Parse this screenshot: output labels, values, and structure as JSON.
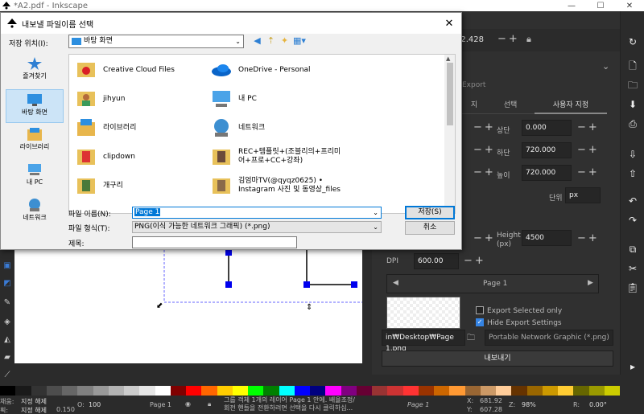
{
  "app": {
    "title": "*A2.pdf - Inkscape",
    "window_controls": [
      "—",
      "☐",
      "✕"
    ]
  },
  "dialog": {
    "title": "내보낼 파일이름 선택",
    "close": "✕",
    "look_in_label": "저장 위치(I):",
    "look_in_value": "바탕 화면",
    "places": [
      {
        "label": "즐겨찾기",
        "icon": "star-icon"
      },
      {
        "label": "바탕 화면",
        "icon": "desktop-icon",
        "selected": true
      },
      {
        "label": "라이브러리",
        "icon": "library-icon"
      },
      {
        "label": "내 PC",
        "icon": "pc-icon"
      },
      {
        "label": "네트워크",
        "icon": "network-icon"
      }
    ],
    "files": [
      {
        "name": "Creative Cloud Files",
        "icon": "cc-folder-icon"
      },
      {
        "name": "OneDrive - Personal",
        "icon": "onedrive-icon"
      },
      {
        "name": "jihyun",
        "icon": "user-folder-icon"
      },
      {
        "name": "내 PC",
        "icon": "pc-icon"
      },
      {
        "name": "라이브러리",
        "icon": "library-folder-icon"
      },
      {
        "name": "네트워크",
        "icon": "network-icon"
      },
      {
        "name": "clipdown",
        "icon": "folder-icon"
      },
      {
        "name": "REC+템플릿+(조블리의+프리미\n어+프로+CC+강좌)",
        "icon": "folder-icon"
      },
      {
        "name": "개구리",
        "icon": "folder-icon"
      },
      {
        "name": "김엄마TV(@qyqz0625) •\nInstagram 사진 및 동영상_files",
        "icon": "folder-icon"
      }
    ],
    "filename_label": "파일 이름(N):",
    "filename_value": "Page 1",
    "filetype_label": "파일 형식(T):",
    "filetype_value": "PNG(이식 가능한 네트워크 그래픽) (*.png)",
    "title_label": "제목:",
    "save_button": "저장(S)",
    "cancel_button": "취소"
  },
  "export_panel": {
    "tabs": [
      "지",
      "선택",
      "사용자 지정"
    ],
    "export_header": "Export",
    "top_value": "22.428",
    "fields": {
      "top_label": "상단",
      "top_value": "0.000",
      "bottom_label": "하단",
      "bottom_value": "720.000",
      "height_label": "높이",
      "height_value": "720.000",
      "unit_label": "단위",
      "unit_value": "px",
      "px_height_label": "Height\n(px)",
      "px_height_value": "4500",
      "dpi_label": "DPI",
      "dpi_value": "600.00"
    },
    "page_nav": "Page 1",
    "export_selected_only": "Export Selected only",
    "hide_export_settings": "Hide Export Settings",
    "path_value": "in₩Desktop₩Page 1.png",
    "format_value": "Portable Network Graphic (*.png)",
    "export_button": "내보내기"
  },
  "statusbar": {
    "fill_label": "채움:",
    "stroke_label": "획:",
    "fill_value": "지정 해제",
    "stroke_value": "지정 해제",
    "stroke_width": "0.150",
    "opacity_label": "O:",
    "opacity_value": "100",
    "page_label": "Page 1",
    "message": "그룹 객체 1개의 레이어 Page 1 안에. 배율조정/\n회전 핸들을 전환하려면 선택을 다시 클릭하십...",
    "page_nav": "Page 1",
    "x_label": "X:",
    "x_value": "681.92",
    "y_label": "Y:",
    "y_value": "607.28",
    "z_label": "Z:",
    "zoom_value": "98%",
    "r_label": "R:",
    "rotate_value": "0.00°"
  },
  "palette": [
    "#000000",
    "#1a1a1a",
    "#333333",
    "#4d4d4d",
    "#666666",
    "#808080",
    "#999999",
    "#b3b3b3",
    "#cccccc",
    "#e6e6e6",
    "#ffffff",
    "#800000",
    "#ff0000",
    "#ff6600",
    "#ffcc00",
    "#ffff00",
    "#00ff00",
    "#008000",
    "#00ffff",
    "#0000ff",
    "#000080",
    "#ff00ff",
    "#800080",
    "#660033",
    "#993333",
    "#cc3333",
    "#ff3333",
    "#993300",
    "#cc6600",
    "#ff9933",
    "#996633",
    "#cc9966",
    "#ffcc99",
    "#663300",
    "#996600",
    "#cc9900",
    "#ffcc33",
    "#666600",
    "#999900",
    "#cccc00"
  ],
  "colors": {
    "accent": "#0078d7",
    "dark_bg": "#2b2b2b",
    "panel_bg": "#303030"
  }
}
